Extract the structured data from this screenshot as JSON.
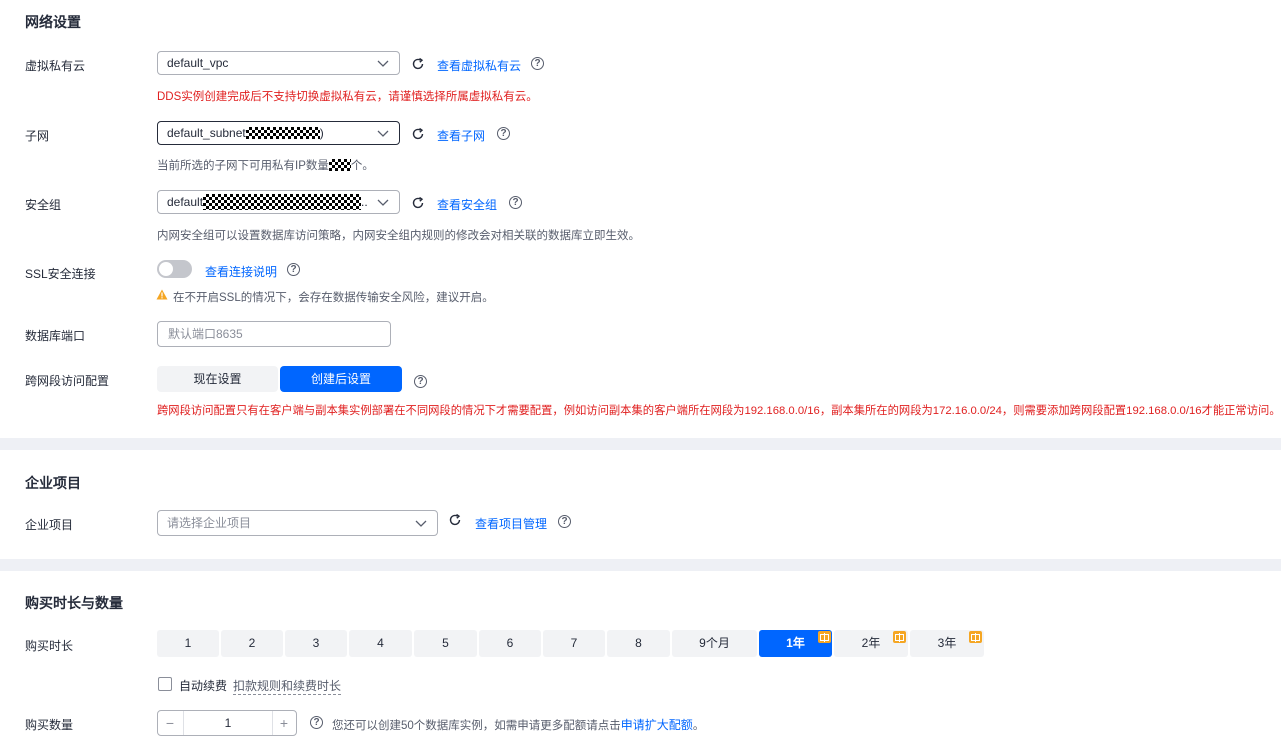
{
  "network": {
    "section_title": "网络设置",
    "vpc": {
      "label": "虚拟私有云",
      "value": "default_vpc",
      "link": "查看虚拟私有云",
      "note": "DDS实例创建完成后不支持切换虚拟私有云，请谨慎选择所属虚拟私有云。"
    },
    "subnet": {
      "label": "子网",
      "value_prefix": "default_subnet",
      "value_suffix": ")",
      "link": "查看子网",
      "note_prefix": "当前所选的子网下可用私有IP数量",
      "note_suffix": "个。"
    },
    "security_group": {
      "label": "安全组",
      "value_prefix": "default",
      "value_suffix": "..",
      "link": "查看安全组",
      "note": "内网安全组可以设置数据库访问策略，内网安全组内规则的修改会对相关联的数据库立即生效。"
    },
    "ssl": {
      "label": "SSL安全连接",
      "enabled": false,
      "link": "查看连接说明",
      "warning": "在不开启SSL的情况下，会存在数据传输安全风险，建议开启。"
    },
    "port": {
      "label": "数据库端口",
      "placeholder": "默认端口8635"
    },
    "cross_segment": {
      "label": "跨网段访问配置",
      "options": [
        "现在设置",
        "创建后设置"
      ],
      "selected": "创建后设置",
      "note": "跨网段访问配置只有在客户端与副本集实例部署在不同网段的情况下才需要配置，例如访问副本集的客户端所在网段为192.168.0.0/16，副本集所在的网段为172.16.0.0/24，则需要添加跨网段配置192.168.0.0/16才能正常访问。"
    }
  },
  "enterprise": {
    "section_title": "企业项目",
    "label": "企业项目",
    "placeholder": "请选择企业项目",
    "link": "查看项目管理"
  },
  "purchase": {
    "section_title": "购买时长与数量",
    "duration_label": "购买时长",
    "durations": [
      "1",
      "2",
      "3",
      "4",
      "5",
      "6",
      "7",
      "8",
      "9个月",
      "1年",
      "2年",
      "3年"
    ],
    "selected_duration": "1年",
    "auto_renew_label": "自动续费",
    "auto_renew_checked": false,
    "auto_renew_link": "扣款规则和续费时长",
    "quantity_label": "购买数量",
    "quantity": "1",
    "minus": "−",
    "plus": "+",
    "quota_note": "您还可以创建50个数据库实例，如需申请更多配额请点击",
    "quota_link": "申请扩大配额",
    "quota_end": "。"
  },
  "icons": {
    "refresh": "refresh-icon",
    "help": "help-icon",
    "chevron": "chevron-down-icon",
    "warning": "warning-icon",
    "gift": "gift-icon"
  },
  "colors": {
    "primary": "#0066ff",
    "error": "#e02020",
    "warning": "#f5a623"
  }
}
